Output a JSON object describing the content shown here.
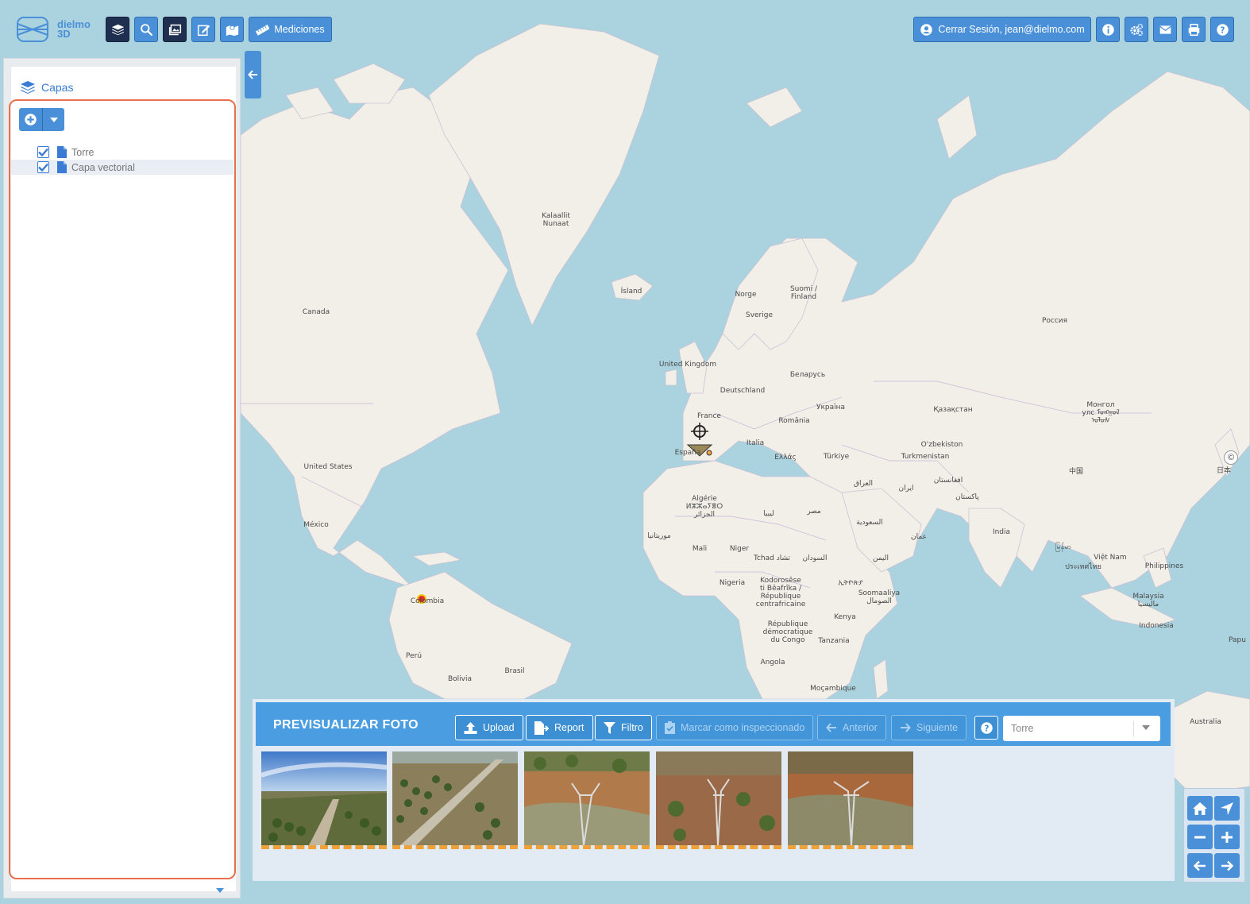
{
  "app": {
    "logo_line1": "dielmo",
    "logo_line2": "3D"
  },
  "toolbar": {
    "layers_button": "layers-icon",
    "search_button": "search-icon",
    "images_button": "images-icon",
    "edit_button": "edit-icon",
    "map_button": "map-marker-icon",
    "measurements_label": "Mediciones",
    "logout_label": "Cerrar Sesión, jean@dielmo.com"
  },
  "layers_panel": {
    "title": "Capas",
    "layers": [
      {
        "name": "Torre",
        "checked": true
      },
      {
        "name": "Capa vectorial",
        "checked": true
      }
    ]
  },
  "map": {
    "labels": [
      "Kalaallit\nNunaat",
      "Ísland",
      "Canada",
      "United States",
      "México",
      "Colombia",
      "Perú",
      "Bolivia",
      "Brasil",
      "United Kingdom",
      "Norge",
      "Sverige",
      "Suomi /\nFinland",
      "France",
      "Deutschland",
      "España",
      "Italia",
      "Беларусь",
      "Україна",
      "România",
      "Ελλάς",
      "Türkiye",
      "Россия",
      "Қазақстан",
      "Монгол\nулс ᠮᠣᠩᠭᠣᠯ\nᠤᠯᠤᠰ",
      "O'zbekiston",
      "Turkmenistan",
      "العراق",
      "ایران",
      "افغانستان",
      "پاکستان",
      "中国",
      "India",
      "ประเทศไทย",
      "မြန်မာ",
      "Việt Nam",
      "Philippines",
      "Malaysia\nماليسيا",
      "Indonesia",
      "日本",
      "Algérie\nⵍⵣⵣⴰⵢⴻⵔ\nالجزائر",
      "ليبيا",
      "مصر",
      "موريتانيا",
      "Mali",
      "Niger",
      "Tchad تشاد",
      "السودان",
      "السعودية",
      "عمان",
      "اليمن",
      "Nigeria",
      "ኢትዮጵያ",
      "Soomaaliya\nالصومال",
      "Kodorosêse\nti Bêafrîka /\nRépublique\ncentrafricaine",
      "Kenya",
      "République\ndémocratique\ndu Congo",
      "Tanzania",
      "Angola",
      "Moçambique",
      "Australia",
      "Papu"
    ]
  },
  "preview": {
    "title": "PREVISUALIZAR FOTO",
    "upload_label": "Upload",
    "report_label": "Report",
    "filter_label": "Filtro",
    "mark_label": "Marcar como inspeccionado",
    "prev_label": "Anterior",
    "next_label": "Siguiente",
    "layer_select_value": "Torre",
    "thumbnails": [
      "photo-1",
      "photo-2",
      "photo-3",
      "photo-4",
      "photo-5"
    ]
  },
  "colors": {
    "accent": "#4a90d9",
    "dark_button": "#1f2f4f",
    "highlight_border": "#e8704d",
    "ocean": "#aad3df",
    "land": "#f2efe9"
  }
}
